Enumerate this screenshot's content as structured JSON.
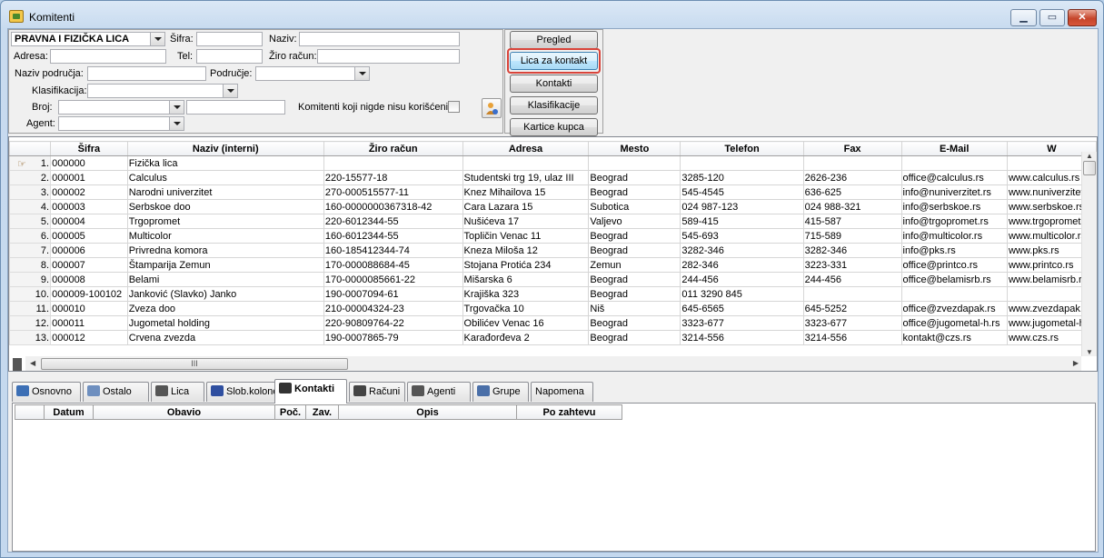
{
  "window": {
    "title": "Komitenti",
    "minimize": "▁",
    "maximize": "▭",
    "close": "✕"
  },
  "filter": {
    "type_selected": "PRAVNA I FIZIČKA LICA",
    "sifra_label": "Šifra:",
    "naziv_label": "Naziv:",
    "adresa_label": "Adresa:",
    "tel_label": "Tel:",
    "ziro_label": "Žiro račun:",
    "naziv_podrucja_label": "Naziv područja:",
    "podrucje_label": "Područje:",
    "klasifikacija_label": "Klasifikacija:",
    "broj_label": "Broj:",
    "agent_label": "Agent:",
    "unused_label": "Komitenti koji nigde nisu korišćeni:"
  },
  "buttons": {
    "pregled": "Pregled",
    "lica_za_kontakt": "Lica za kontakt",
    "kontakti": "Kontakti",
    "klasifikacije": "Klasifikacije",
    "kartice_kupca": "Kartice kupca"
  },
  "grid": {
    "columns": [
      "Šifra",
      "Naziv (interni)",
      "Žiro račun",
      "Adresa",
      "Mesto",
      "Telefon",
      "Fax",
      "E-Mail",
      "W"
    ],
    "rows": [
      {
        "n": "1.",
        "sifra": "000000",
        "naziv": "Fizička lica",
        "ziro": "",
        "adresa": "",
        "mesto": "",
        "tel": "",
        "fax": "",
        "email": "",
        "web": ""
      },
      {
        "n": "2.",
        "sifra": "000001",
        "naziv": "Calculus",
        "ziro": "220-15577-18",
        "adresa": "Studentski trg 19, ulaz III",
        "mesto": "Beograd",
        "tel": "3285-120",
        "fax": "2626-236",
        "email": "office@calculus.rs",
        "web": "www.calculus.rs"
      },
      {
        "n": "3.",
        "sifra": "000002",
        "naziv": "Narodni univerzitet",
        "ziro": "270-000515577-11",
        "adresa": "Knez Mihailova 15",
        "mesto": "Beograd",
        "tel": "545-4545",
        "fax": "636-625",
        "email": "info@nuniverzitet.rs",
        "web": "www.nuniverzitet.rs"
      },
      {
        "n": "4.",
        "sifra": "000003",
        "naziv": "Serbskoe doo",
        "ziro": "160-0000000367318-42",
        "adresa": "Cara Lazara 15",
        "mesto": "Subotica",
        "tel": "024 987-123",
        "fax": "024 988-321",
        "email": "info@serbskoe.rs",
        "web": "www.serbskoe.rs"
      },
      {
        "n": "5.",
        "sifra": "000004",
        "naziv": "Trgopromet",
        "ziro": "220-6012344-55",
        "adresa": "Nušićeva 17",
        "mesto": "Valjevo",
        "tel": "589-415",
        "fax": "415-587",
        "email": "info@trgopromet.rs",
        "web": "www.trgopromet.rs"
      },
      {
        "n": "6.",
        "sifra": "000005",
        "naziv": "Multicolor",
        "ziro": "160-6012344-55",
        "adresa": "Topličin Venac 11",
        "mesto": "Beograd",
        "tel": "545-693",
        "fax": "715-589",
        "email": "info@multicolor.rs",
        "web": "www.multicolor.rs"
      },
      {
        "n": "7.",
        "sifra": "000006",
        "naziv": "Privredna komora",
        "ziro": "160-185412344-74",
        "adresa": "Kneza Miloša 12",
        "mesto": "Beograd",
        "tel": "3282-346",
        "fax": "3282-346",
        "email": "info@pks.rs",
        "web": "www.pks.rs"
      },
      {
        "n": "8.",
        "sifra": "000007",
        "naziv": "Štamparija Zemun",
        "ziro": "170-000088684-45",
        "adresa": "Stojana Protića 234",
        "mesto": "Zemun",
        "tel": "282-346",
        "fax": "3223-331",
        "email": "office@printco.rs",
        "web": "www.printco.rs"
      },
      {
        "n": "9.",
        "sifra": "000008",
        "naziv": "Belami",
        "ziro": "170-0000085661-22",
        "adresa": "Mišarska 6",
        "mesto": "Beograd",
        "tel": "244-456",
        "fax": "244-456",
        "email": "office@belamisrb.rs",
        "web": "www.belamisrb.rs"
      },
      {
        "n": "10.",
        "sifra": "000009-100102",
        "naziv": "Janković (Slavko) Janko",
        "ziro": "190-0007094-61",
        "adresa": "Krajiška 323",
        "mesto": "Beograd",
        "tel": "011 3290 845",
        "fax": "",
        "email": "",
        "web": ""
      },
      {
        "n": "11.",
        "sifra": "000010",
        "naziv": "Zveza doo",
        "ziro": "210-00004324-23",
        "adresa": "Trgovačka 10",
        "mesto": "Niš",
        "tel": "645-6565",
        "fax": "645-5252",
        "email": "office@zvezdapak.rs",
        "web": "www.zvezdapak.rs"
      },
      {
        "n": "12.",
        "sifra": "000011",
        "naziv": "Jugometal holding",
        "ziro": "220-90809764-22",
        "adresa": "Obilićev Venac 16",
        "mesto": "Beograd",
        "tel": "3323-677",
        "fax": "3323-677",
        "email": "office@jugometal-h.rs",
        "web": "www.jugometal-h.rs"
      },
      {
        "n": "13.",
        "sifra": "000012",
        "naziv": "Crvena zvezda",
        "ziro": "190-0007865-79",
        "adresa": "Karađorđeva 2",
        "mesto": "Beograd",
        "tel": "3214-556",
        "fax": "3214-556",
        "email": "kontakt@czs.rs",
        "web": "www.czs.rs"
      }
    ],
    "hthumb_grip": "III"
  },
  "tabs": [
    {
      "label": "Osnovno",
      "icon": "basic-icon",
      "color": "#3c6fb5"
    },
    {
      "label": "Ostalo",
      "icon": "document-icon",
      "color": "#6e8fbf"
    },
    {
      "label": "Lica",
      "icon": "phone-icon",
      "color": "#555555"
    },
    {
      "label": "Slob.kolone",
      "icon": "butterfly-icon",
      "color": "#2f4fa0"
    },
    {
      "label": "Kontakti",
      "icon": "hand-icon",
      "color": "#333333"
    },
    {
      "label": "Računi",
      "icon": "account-icon",
      "color": "#444444"
    },
    {
      "label": "Agenti",
      "icon": "agent-icon",
      "color": "#555555"
    },
    {
      "label": "Grupe",
      "icon": "groups-icon",
      "color": "#4a6fa8"
    },
    {
      "label": "Napomena",
      "icon": "",
      "color": ""
    }
  ],
  "lower_grid": {
    "columns": [
      "Datum",
      "Obavio",
      "Poč.",
      "Zav.",
      "Opis",
      "Po zahtevu"
    ]
  }
}
